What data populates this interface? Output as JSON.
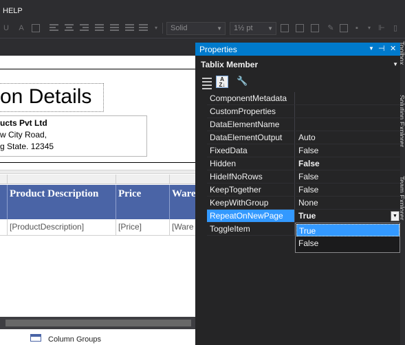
{
  "menu": {
    "help": "HELP"
  },
  "toolbar": {
    "line_style": "Solid",
    "line_width": "1½ pt"
  },
  "report": {
    "title": "on Details",
    "address": [
      "ucts Pvt Ltd",
      "w City Road,",
      "g State. 12345"
    ],
    "columns": [
      "",
      "Product Description",
      "Price",
      "Ware"
    ],
    "row": [
      "",
      "[ProductDescription]",
      "[Price]",
      "[Ware"
    ]
  },
  "bottom": {
    "column_groups": "Column Groups"
  },
  "properties": {
    "title": "Properties",
    "object": "Tablix Member",
    "rows": [
      {
        "name": "ComponentMetadata",
        "value": ""
      },
      {
        "name": "CustomProperties",
        "value": ""
      },
      {
        "name": "DataElementName",
        "value": ""
      },
      {
        "name": "DataElementOutput",
        "value": "Auto"
      },
      {
        "name": "FixedData",
        "value": "False"
      },
      {
        "name": "Hidden",
        "value": "False"
      },
      {
        "name": "HideIfNoRows",
        "value": "False"
      },
      {
        "name": "KeepTogether",
        "value": "False"
      },
      {
        "name": "KeepWithGroup",
        "value": "None"
      },
      {
        "name": "RepeatOnNewPage",
        "value": "True"
      },
      {
        "name": "ToggleItem",
        "value": ""
      }
    ],
    "dropdown_options": [
      "True",
      "False"
    ]
  },
  "side_tabs": [
    "Toolbox",
    "Solution Explorer",
    "Team Explorer"
  ],
  "colors": {
    "accent": "#007acc",
    "selection": "#3399ff",
    "table_header": "#4a64a6",
    "panel_bg": "#252526"
  }
}
